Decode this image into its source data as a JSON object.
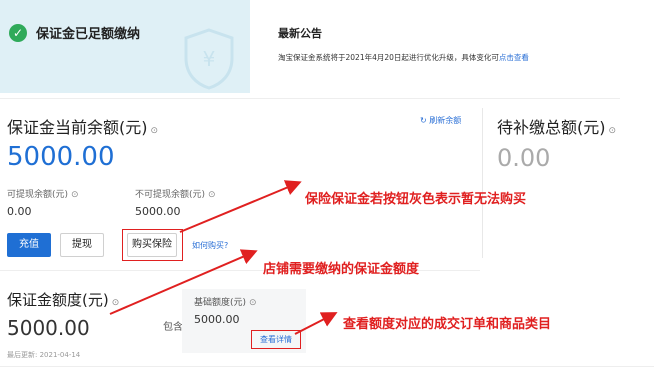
{
  "status": {
    "text": "保证金已足额缴纳",
    "icon": "check-circle-icon",
    "watermark_icon": "yen-shield-icon"
  },
  "notice": {
    "title": "最新公告",
    "body": "淘宝保证金系统将于2021年4月20日起进行优化升级，具体变化可",
    "link": "点击查看"
  },
  "balance": {
    "title": "保证金当前余额(元)",
    "amount": "5000.00",
    "refresh_label": "刷新余额",
    "withdrawable_label": "可提现余额(元)",
    "withdrawable_value": "0.00",
    "non_withdrawable_label": "不可提现余额(元)",
    "non_withdrawable_value": "5000.00"
  },
  "pending": {
    "title": "待补缴总额(元)",
    "amount": "0.00"
  },
  "actions": {
    "recharge": "充值",
    "withdraw": "提现",
    "buy_insurance": "购买保险",
    "how_to_buy": "如何购买?"
  },
  "quota": {
    "title": "保证金额度(元)",
    "amount": "5000.00",
    "updated": "最后更新: 2021-04-14",
    "contains": "包含",
    "basic_label": "基础额度(元)",
    "basic_value": "5000.00",
    "view_details": "查看详情"
  },
  "annotations": {
    "a1": "保险保证金若按钮灰色表示暂无法购买",
    "a2": "店铺需要缴纳的保证金额度",
    "a3": "查看额度对应的成交订单和商品类目"
  },
  "colors": {
    "accent": "#1f6fd4",
    "annotation": "#e02020",
    "success": "#2faa5a",
    "status_bg": "#dff0f6"
  }
}
